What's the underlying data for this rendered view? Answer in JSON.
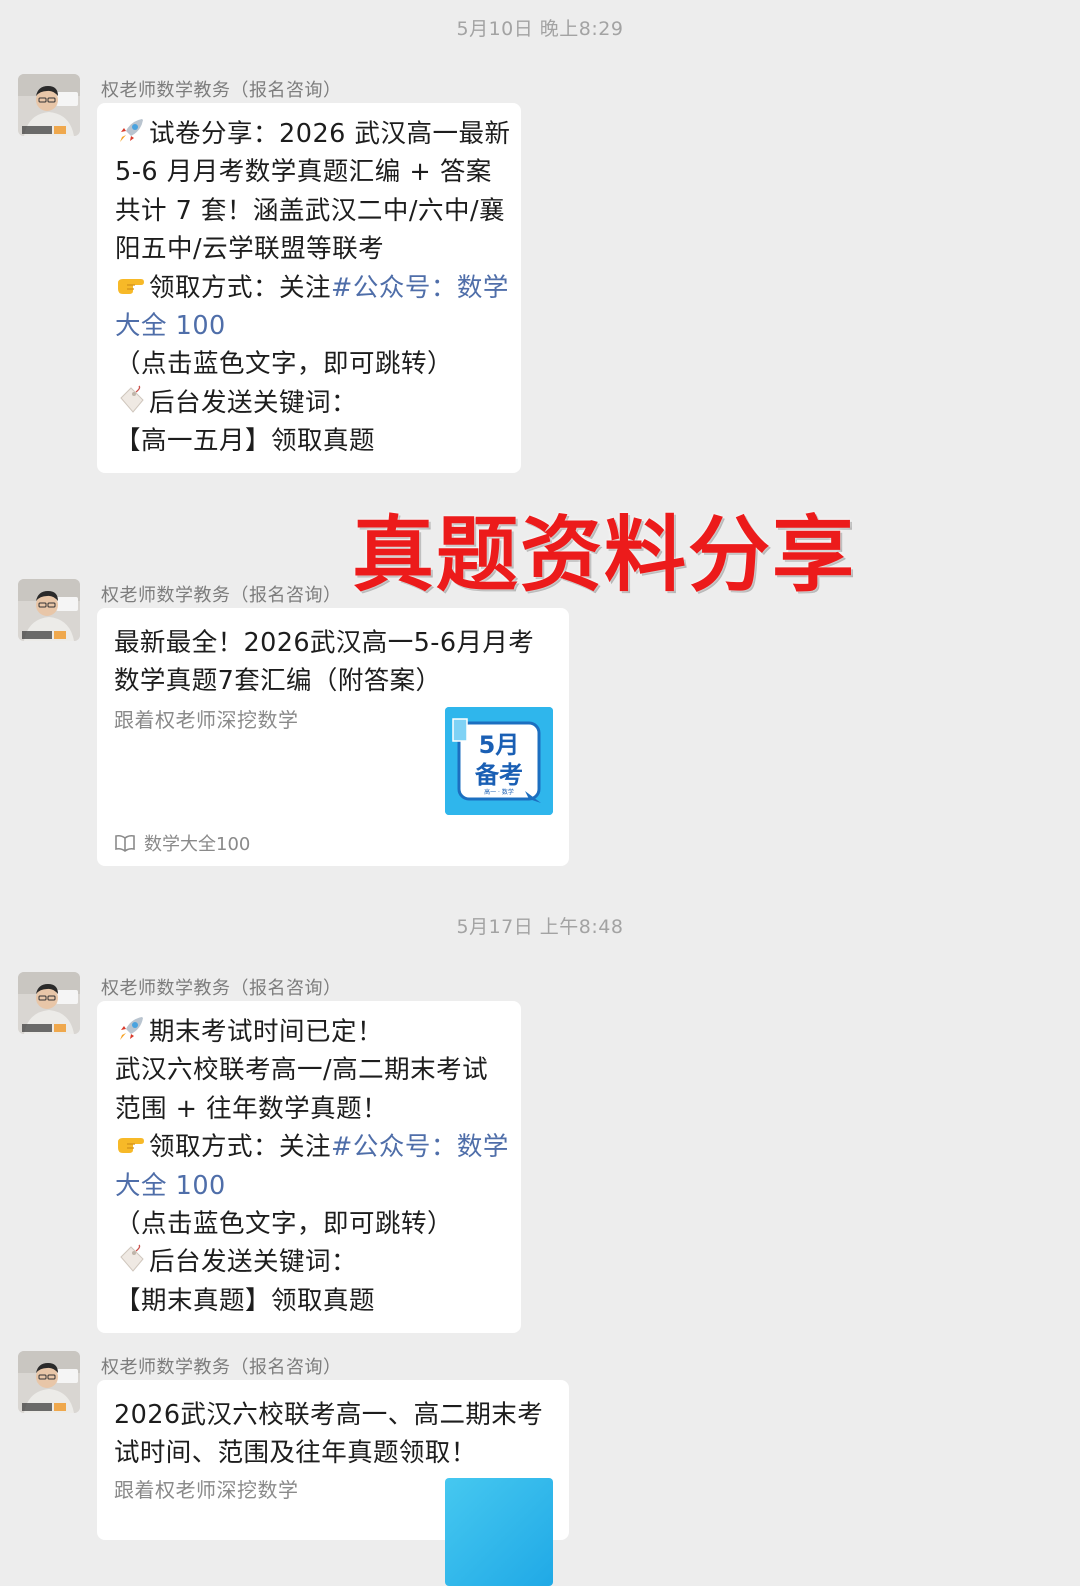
{
  "timestamps": [
    "5月10日 晚上8:29",
    "5月17日 上午8:48"
  ],
  "sender_name": "权老师数学教务（报名咨询）",
  "overlay_title": "真题资料分享",
  "accent_blue": "#4f6ea9",
  "overlay_red": "#ec1b1b",
  "messages": {
    "m1": {
      "lines": [
        "试卷分享：2026 武汉高一最新",
        "5-6 月月考数学真题汇编 + 答案",
        "共计 7 套！涵盖武汉二中/六中/襄",
        "阳五中/云学联盟等联考",
        "领取方式：关注",
        "#公众号：数学",
        "大全 100",
        "（点击蓝色文字，即可跳转）",
        "后台发送关键词：",
        "【高一五月】领取真题"
      ]
    },
    "card1": {
      "title_line1": "最新最全！2026武汉高一5-6月月考",
      "title_line2": "数学真题7套汇编（附答案）",
      "subtitle": "跟着权老师深挖数学",
      "source": "数学大全100",
      "thumb_text1": "5月",
      "thumb_text2": "备考",
      "thumb_small": "高一 · 数学"
    },
    "m2": {
      "lines": [
        "期末考试时间已定！",
        "武汉六校联考高一/高二期末考试",
        "范围 + 往年数学真题！",
        "领取方式：关注",
        "#公众号：数学",
        "大全 100",
        "（点击蓝色文字，即可跳转）",
        "后台发送关键词：",
        "【期末真题】领取真题"
      ]
    },
    "card2": {
      "title_line1": "2026武汉六校联考高一、高二期末考",
      "title_line2": "试时间、范围及往年真题领取！",
      "subtitle": "跟着权老师深挖数学"
    }
  },
  "icons": [
    "rocket-icon",
    "pointing-hand-icon",
    "tag-icon",
    "book-icon",
    "avatar"
  ]
}
